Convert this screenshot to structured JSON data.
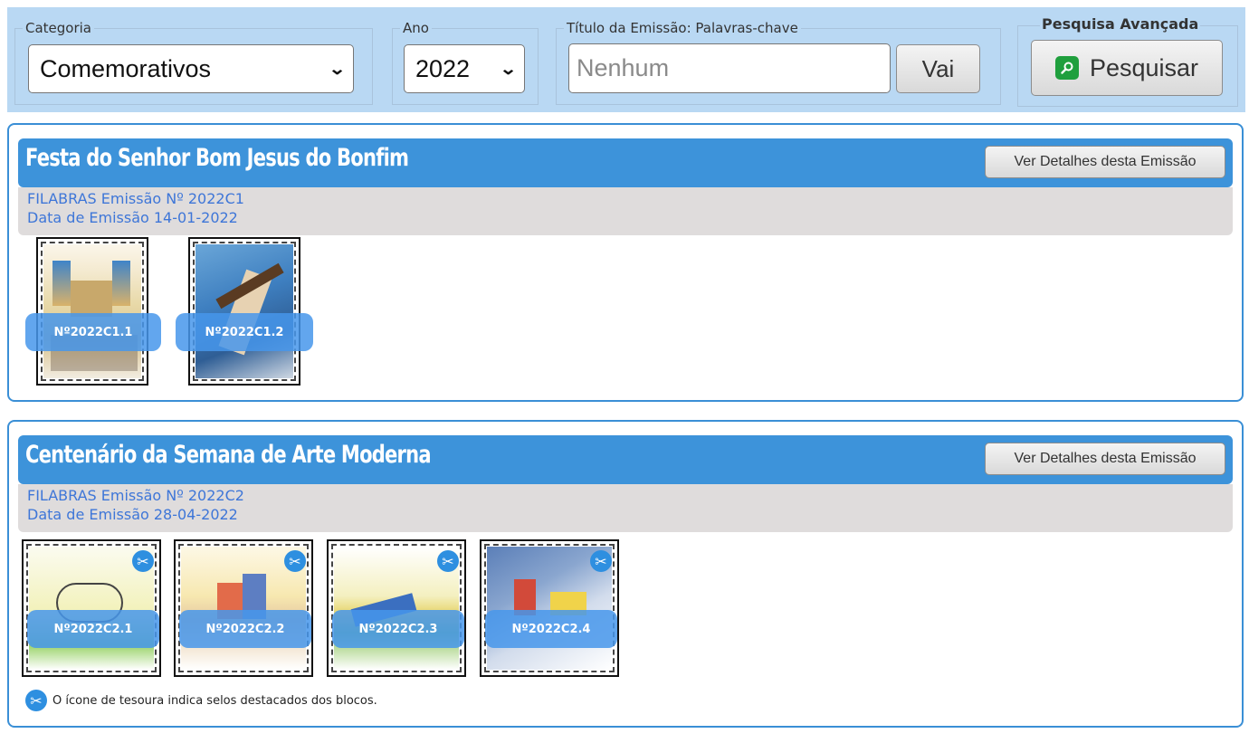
{
  "filters": {
    "category": {
      "legend": "Categoria",
      "selected": "Comemorativos"
    },
    "year": {
      "legend": "Ano",
      "selected": "2022"
    },
    "title_search": {
      "legend": "Título da Emissão: Palavras-chave",
      "placeholder": "Nenhum",
      "go_label": "Vai"
    },
    "advanced": {
      "legend": "Pesquisa Avançada",
      "button_label": "Pesquisar"
    }
  },
  "emissions": [
    {
      "title": "Festa do Senhor Bom Jesus do Bonfim",
      "details_label": "Ver Detalhes desta Emissão",
      "number_line": "FILABRAS Emissão Nº 2022C1",
      "date_line": "Data de Emissão 14-01-2022",
      "stamps": [
        {
          "code": "Nº2022C1.1",
          "scissors": false
        },
        {
          "code": "Nº2022C1.2",
          "scissors": false
        }
      ]
    },
    {
      "title": "Centenário da Semana de Arte Moderna",
      "details_label": "Ver Detalhes desta Emissão",
      "number_line": "FILABRAS Emissão Nº 2022C2",
      "date_line": "Data de Emissão 28-04-2022",
      "stamps": [
        {
          "code": "Nº2022C2.1",
          "scissors": true
        },
        {
          "code": "Nº2022C2.2",
          "scissors": true
        },
        {
          "code": "Nº2022C2.3",
          "scissors": true
        },
        {
          "code": "Nº2022C2.4",
          "scissors": true
        }
      ],
      "note": "O ícone de tesoura indica selos destacados dos blocos."
    }
  ],
  "icons": {
    "select_arrow": "chevron-down-icon",
    "search": "search-icon",
    "scissors": "scissors-icon"
  },
  "colors": {
    "accent": "#3d93da",
    "topbar": "#b9d8f3",
    "link_text": "#3e76d8",
    "search_green": "#1f9f3d"
  }
}
